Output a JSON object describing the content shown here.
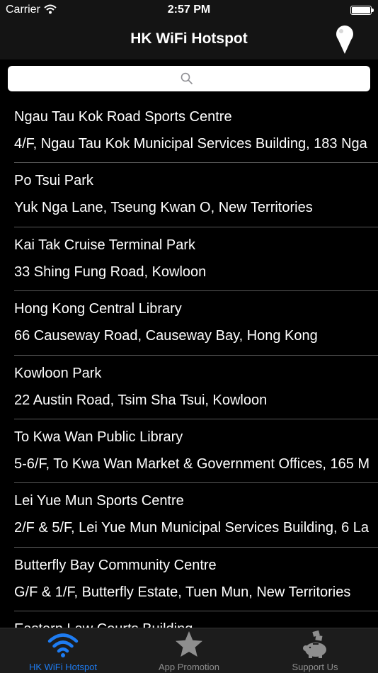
{
  "status_bar": {
    "carrier": "Carrier",
    "time": "2:57 PM"
  },
  "nav": {
    "title": "HK WiFi Hotspot"
  },
  "search": {
    "placeholder": "",
    "value": ""
  },
  "list": [
    {
      "name": "Ngau Tau Kok Road Sports Centre",
      "address": "4/F, Ngau Tau Kok Municipal Services Building, 183 Nga"
    },
    {
      "name": "Po Tsui Park",
      "address": "Yuk Nga Lane, Tseung Kwan O, New Territories"
    },
    {
      "name": "Kai Tak Cruise Terminal Park",
      "address": "33 Shing Fung Road, Kowloon"
    },
    {
      "name": "Hong Kong Central Library",
      "address": "66 Causeway Road, Causeway Bay, Hong Kong"
    },
    {
      "name": "Kowloon Park",
      "address": "22 Austin Road, Tsim Sha Tsui, Kowloon"
    },
    {
      "name": "To Kwa Wan Public Library",
      "address": "5-6/F, To Kwa Wan Market & Government Offices, 165 M"
    },
    {
      "name": "Lei Yue Mun Sports Centre",
      "address": "2/F & 5/F, Lei Yue Mun Municipal Services Building, 6 La"
    },
    {
      "name": "Butterfly Bay Community Centre",
      "address": "G/F & 1/F, Butterfly Estate, Tuen Mun, New Territories"
    },
    {
      "name": "Eastern Law Courts Building",
      "address": ""
    }
  ],
  "tabs": [
    {
      "label": "HK WiFi Hotspot",
      "icon": "wifi-icon",
      "active": true
    },
    {
      "label": "App Promotion",
      "icon": "star-icon",
      "active": false
    },
    {
      "label": "Support Us",
      "icon": "piggy-bank-icon",
      "active": false
    }
  ],
  "colors": {
    "accent": "#1e7cf2",
    "bar_background": "#141414",
    "tab_inactive": "#8e8e8e",
    "separator": "#5a5a5a"
  }
}
